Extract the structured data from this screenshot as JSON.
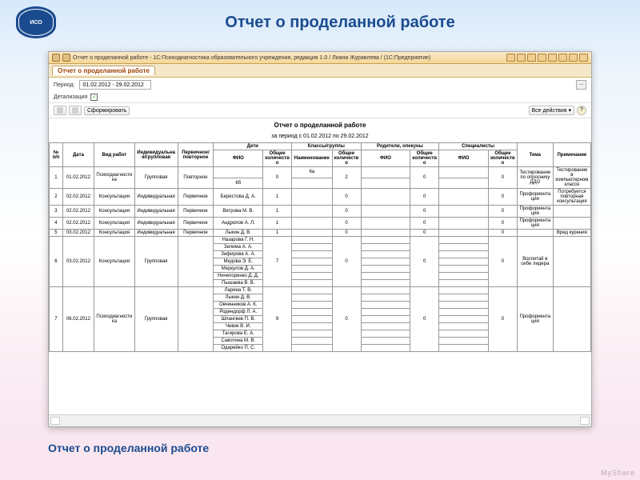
{
  "slide": {
    "title": "Отчет о проделанной работе",
    "footer": "Отчет о проделанной работе",
    "watermark": "MyShare"
  },
  "logo": {
    "text": "ИСО"
  },
  "window": {
    "title": "Отчет о проделанной работе - 1С:Психодиагностика образовательного учреждения, редакция 1.0 / Лиана Журавлева / (1С:Предприятие)"
  },
  "tab": {
    "label": "Отчет о проделанной работе"
  },
  "params": {
    "periodLabel": "Период:",
    "periodValue": "01.02.2012 - 29.02.2012",
    "detailLabel": "Детализация",
    "detailChecked": "✓"
  },
  "toolbar": {
    "form": "Сформировать",
    "allActions": "Все действия ▾"
  },
  "report": {
    "title": "Отчет о проделанной работе",
    "subtitle": "за период с 01.02.2012 по 29.02.2012"
  },
  "headers": {
    "n": "№ п/п",
    "date": "Дата",
    "type": "Вид работ",
    "group": "Индивидуальная/групповая",
    "primary": "Первичное/повторное",
    "children": "Дети",
    "classes": "Классы/группы",
    "parents": "Родители, опекуны",
    "specialists": "Специалисты",
    "fio": "ФИО",
    "count": "Общее количество",
    "name": "Наименование",
    "tema": "Тема",
    "note": "Примечание"
  },
  "rows": [
    {
      "n": "1",
      "date": "01.02.2012",
      "type": "Психодиагностика",
      "grp": "Групповая",
      "prim": "Повторное",
      "fio": "",
      "cnt": "0",
      "cls": "6а",
      "ccnt": "2",
      "pfio": "",
      "pcnt": "0",
      "sfio": "",
      "scnt": "0",
      "tema": "Тестирование по опроснику ДДО",
      "note": "Тестирование в компьютерном классе",
      "sub": [
        "6б"
      ]
    },
    {
      "n": "2",
      "date": "02.02.2012",
      "type": "Консультация",
      "grp": "Индивидуальная",
      "prim": "Первичное",
      "fio": "Берестова Д. А.",
      "cnt": "1",
      "cls": "",
      "ccnt": "0",
      "pfio": "",
      "pcnt": "0",
      "sfio": "",
      "scnt": "0",
      "tema": "Профориентация",
      "note": "Потребуется повторная консультация"
    },
    {
      "n": "3",
      "date": "02.02.2012",
      "type": "Консультация",
      "grp": "Индивидуальная",
      "prim": "Первичное",
      "fio": "Ветрова М. В.",
      "cnt": "1",
      "cls": "",
      "ccnt": "0",
      "pfio": "",
      "pcnt": "0",
      "sfio": "",
      "scnt": "0",
      "tema": "Профориентация",
      "note": ""
    },
    {
      "n": "4",
      "date": "02.02.2012",
      "type": "Консультация",
      "grp": "Индивидуальная",
      "prim": "Первичное",
      "fio": "Андропов А. Л.",
      "cnt": "1",
      "cls": "",
      "ccnt": "0",
      "pfio": "",
      "pcnt": "0",
      "sfio": "",
      "scnt": "0",
      "tema": "Профориентация",
      "note": ""
    },
    {
      "n": "5",
      "date": "03.02.2012",
      "type": "Консультация",
      "grp": "Индивидуальная",
      "prim": "Первичное",
      "fio": "Лыкин Д. В.",
      "cnt": "1",
      "cls": "",
      "ccnt": "0",
      "pfio": "",
      "pcnt": "0",
      "sfio": "",
      "scnt": "0",
      "tema": "",
      "note": "Вред курения"
    },
    {
      "n": "6",
      "date": "03.02.2012",
      "type": "Консультация",
      "grp": "Групповая",
      "prim": "",
      "fio": "Назарова Г. Н.",
      "cnt": "7",
      "cls": "",
      "ccnt": "0",
      "pfio": "",
      "pcnt": "0",
      "sfio": "",
      "scnt": "0",
      "tema": "Воспитай в себе лидера",
      "note": "",
      "sub": [
        "Зелима А. А.",
        "Зифирова А. А.",
        "Медова Э. Е.",
        "Меркулов Д. А.",
        "Ничепоренко Д. Д.",
        "Пышаева В. В."
      ]
    },
    {
      "n": "7",
      "date": "06.02.2012",
      "type": "Психодиагностика",
      "grp": "Групповая",
      "prim": "",
      "fio": "Ларина Т. В.",
      "cnt": "9",
      "cls": "",
      "ccnt": "0",
      "pfio": "",
      "pcnt": "0",
      "sfio": "",
      "scnt": "0",
      "tema": "Профориентация",
      "note": "",
      "sub": [
        "Лыкин Д. В.",
        "Овчинников А. К.",
        "Родендорф Л. А.",
        "Шлангвев П. В.",
        "Чевик В. И.",
        "Тагирова Е. А.",
        "Савотина М. В.",
        "Одарейко П. С."
      ]
    }
  ]
}
